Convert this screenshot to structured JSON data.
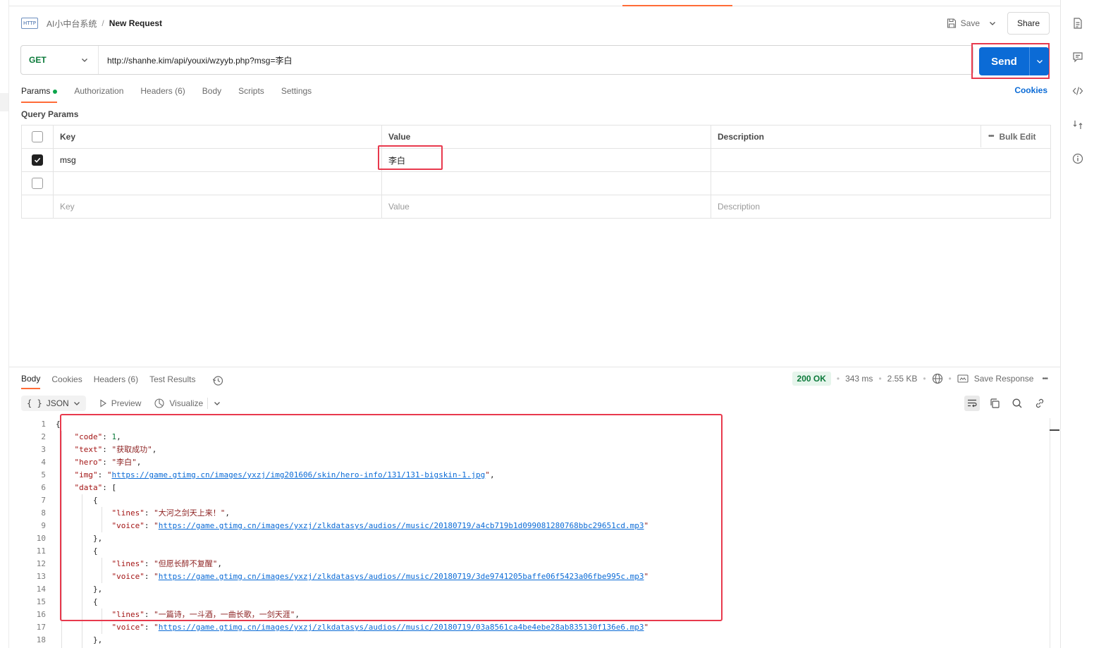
{
  "breadcrumb": {
    "parent": "AI小中台系统",
    "separator": "/",
    "current": "New Request"
  },
  "header": {
    "save_label": "Save",
    "share_label": "Share"
  },
  "request": {
    "method": "GET",
    "url": "http://shanhe.kim/api/youxi/wzyyb.php?msg=李白",
    "send_label": "Send"
  },
  "tabs": {
    "params": "Params",
    "authorization": "Authorization",
    "headers": "Headers",
    "headers_count": "(6)",
    "body": "Body",
    "scripts": "Scripts",
    "settings": "Settings",
    "cookies": "Cookies"
  },
  "query_params": {
    "title": "Query Params",
    "columns": {
      "key": "Key",
      "value": "Value",
      "description": "Description",
      "bulk_edit": "Bulk Edit"
    },
    "rows": [
      {
        "checked": true,
        "key": "msg",
        "value": "李白",
        "description": ""
      }
    ],
    "placeholders": {
      "key": "Key",
      "value": "Value",
      "description": "Description"
    }
  },
  "response": {
    "tabs": {
      "body": "Body",
      "cookies": "Cookies",
      "headers": "Headers",
      "headers_count": "(6)",
      "test_results": "Test Results"
    },
    "status": "200 OK",
    "time": "343 ms",
    "size": "2.55 KB",
    "save_response": "Save Response",
    "format": "JSON",
    "preview": "Preview",
    "visualize": "Visualize"
  },
  "code_lines": [
    "1",
    "2",
    "3",
    "4",
    "5",
    "6",
    "7",
    "8",
    "9",
    "10",
    "11",
    "12",
    "13",
    "14",
    "15",
    "16",
    "17",
    "18"
  ],
  "json_body": {
    "code_key": "\"code\"",
    "code_val": "1",
    "text_key": "\"text\"",
    "text_val": "\"获取成功\"",
    "hero_key": "\"hero\"",
    "hero_val": "\"李白\"",
    "img_key": "\"img\"",
    "img_val": "https://game.gtimg.cn/images/yxzj/img201606/skin/hero-info/131/131-bigskin-1.jpg",
    "data_key": "\"data\"",
    "lines_key": "\"lines\"",
    "voice_key": "\"voice\"",
    "lines_1": "\"大河之剑天上来！\"",
    "voice_1": "https://game.gtimg.cn/images/yxzj/zlkdatasys/audios//music/20180719/a4cb719b1d099081280768bbc29651cd.mp3",
    "lines_2": "\"但愿长醉不复醒\"",
    "voice_2": "https://game.gtimg.cn/images/yxzj/zlkdatasys/audios//music/20180719/3de9741205baffe06f5423a06fbe995c.mp3",
    "lines_3": "\"一篇诗，一斗酒，一曲长歌，一剑天涯\"",
    "voice_3": "https://game.gtimg.cn/images/yxzj/zlkdatasys/audios//music/20180719/03a8561ca4be4ebe28ab835130f136e6.mp3"
  },
  "colors": {
    "accent": "#ff6c37",
    "send": "#0b6bd6",
    "highlight": "#e8394d",
    "method": "#0b7a3a"
  }
}
